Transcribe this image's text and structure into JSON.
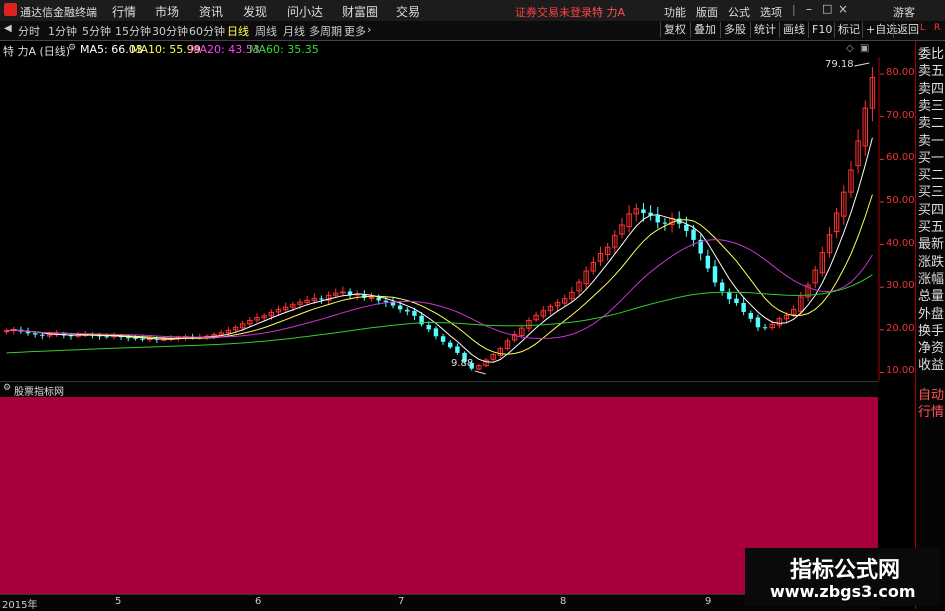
{
  "app": {
    "title": "通达信金融终端",
    "user": "游客"
  },
  "menu": [
    "行情",
    "市场",
    "资讯",
    "发现",
    "问小达",
    "财富圈",
    "交易"
  ],
  "notice": "证券交易未登录",
  "stock_name": "特 力A",
  "right_menu": [
    "功能",
    "版面",
    "公式",
    "选项"
  ],
  "periods": [
    {
      "label": "分时",
      "active": false
    },
    {
      "label": "1分钟",
      "active": false
    },
    {
      "label": "5分钟",
      "active": false
    },
    {
      "label": "15分钟",
      "active": false
    },
    {
      "label": "30分钟",
      "active": false
    },
    {
      "label": "60分钟",
      "active": false
    },
    {
      "label": "日线",
      "active": true
    },
    {
      "label": "周线",
      "active": false
    },
    {
      "label": "月线",
      "active": false
    },
    {
      "label": "多周期",
      "active": false
    },
    {
      "label": "更多",
      "active": false
    }
  ],
  "toolbar_right": [
    "复权",
    "叠加",
    "多股",
    "统计",
    "画线",
    "F10",
    "标记",
    "+自选",
    "返回"
  ],
  "info": {
    "name": "特 力A (日线)",
    "ma": [
      {
        "label": "MA5: 66.03",
        "color": "#ffffff"
      },
      {
        "label": "MA10: 55.99",
        "color": "#ffff55"
      },
      {
        "label": "MA20: 43.53",
        "color": "#ff44ff"
      },
      {
        "label": "MA60: 35.35",
        "color": "#33dd33"
      }
    ]
  },
  "price_axis": {
    "ticks": [
      "80.00",
      "70.00",
      "60.00",
      "50.00",
      "40.00",
      "30.00",
      "20.00",
      "10.00"
    ]
  },
  "annotations": {
    "high": "79.18",
    "low": "9.88"
  },
  "sidebar": [
    "委比",
    "卖五",
    "卖四",
    "卖三",
    "卖二",
    "卖一",
    "买一",
    "买二",
    "买三",
    "买四",
    "买五",
    "最新",
    "涨跌",
    "涨幅",
    "总量",
    "外盘",
    "换手",
    "净资",
    "收益",
    "自动",
    "行情"
  ],
  "sidebar_top": {
    "a": "L",
    "b": "R"
  },
  "indicator": {
    "title": "股票指标网"
  },
  "x_axis": [
    "2015年",
    "5",
    "6",
    "7",
    "8",
    "9"
  ],
  "watermark": {
    "line1": "指标公式网",
    "line2": "www.zbgs3.com"
  },
  "colors": {
    "up": "#ff3232",
    "down": "#54ffff",
    "ma5": "#ffffff",
    "ma10": "#ffff55",
    "ma20": "#cc33cc",
    "ma60": "#33cc33",
    "indicator_bg": "#a8003c"
  },
  "chart_data": {
    "type": "candlestick",
    "ylim": [
      8,
      84
    ],
    "close": [
      19.8,
      20.1,
      19.6,
      19.2,
      18.9,
      18.6,
      18.9,
      19.1,
      18.7,
      18.5,
      18.8,
      18.9,
      18.7,
      18.5,
      18.4,
      18.6,
      18.3,
      18.1,
      17.9,
      17.8,
      17.9,
      17.7,
      17.8,
      18.0,
      18.2,
      18.4,
      18.2,
      18.3,
      18.5,
      18.9,
      19.3,
      19.9,
      20.6,
      21.4,
      22.2,
      22.9,
      23.3,
      24.1,
      24.8,
      25.3,
      25.9,
      26.5,
      26.9,
      27.4,
      27.1,
      28.1,
      28.6,
      28.9,
      28.2,
      28.4,
      27.5,
      27.6,
      26.9,
      26.5,
      25.7,
      24.8,
      24.3,
      23.3,
      21.3,
      20.1,
      18.5,
      17.2,
      15.9,
      14.6,
      12.5,
      10.9,
      11.6,
      12.9,
      14.2,
      15.6,
      17.4,
      18.9,
      20.4,
      22.2,
      23.4,
      24.5,
      25.5,
      26.4,
      27.3,
      28.8,
      31.2,
      33.8,
      35.8,
      37.9,
      39.4,
      42.1,
      44.6,
      47.2,
      48.4,
      47.4,
      46.8,
      45.2,
      44.9,
      46.1,
      44.9,
      43.2,
      41.1,
      37.9,
      34.4,
      31.1,
      29.1,
      27.2,
      26.3,
      24.2,
      22.6,
      20.6,
      20.4,
      21.3,
      22.6,
      23.4,
      24.8,
      27.7,
      30.5,
      34.0,
      38.1,
      42.3,
      47.4,
      52.3,
      57.5,
      64.3,
      72.0,
      79.18
    ]
  }
}
